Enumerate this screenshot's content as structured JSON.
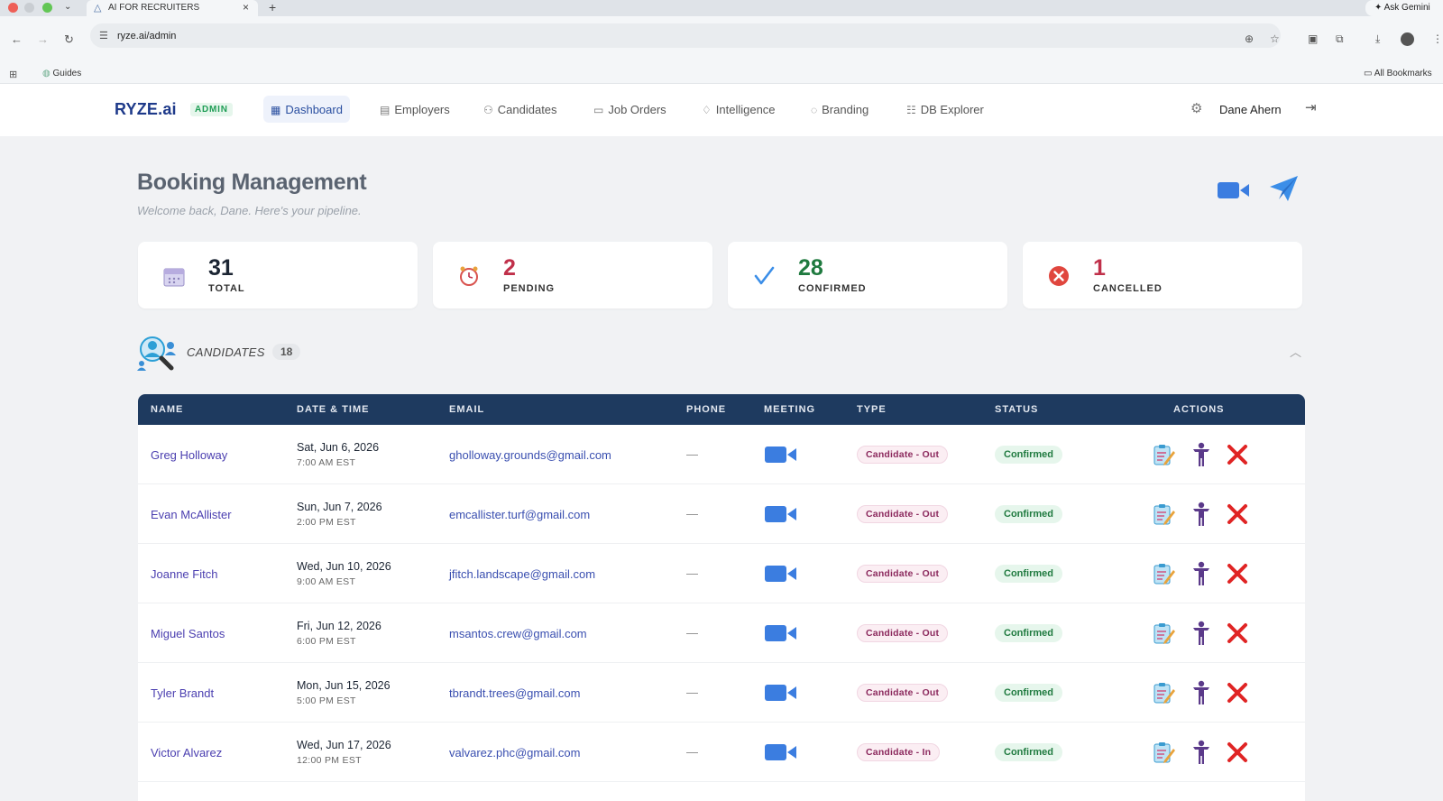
{
  "browser": {
    "tab_title": "AI FOR RECRUITERS",
    "url": "ryze.ai/admin",
    "gemini": "Ask Gemini",
    "bookmark_guides": "Guides",
    "bookmark_all": "All Bookmarks"
  },
  "nav": {
    "logo": "RYZE.ai",
    "admin_badge": "ADMIN",
    "items": [
      {
        "label": "Dashboard",
        "icon": "grid-icon"
      },
      {
        "label": "Employers",
        "icon": "building-icon"
      },
      {
        "label": "Candidates",
        "icon": "people-icon"
      },
      {
        "label": "Job Orders",
        "icon": "briefcase-icon"
      },
      {
        "label": "Intelligence",
        "icon": "lightbulb-icon"
      },
      {
        "label": "Branding",
        "icon": "palette-icon"
      },
      {
        "label": "DB Explorer",
        "icon": "database-icon"
      }
    ],
    "user_name": "Dane Ahern"
  },
  "page": {
    "title": "Booking Management",
    "subtitle": "Welcome back, Dane. Here's your pipeline."
  },
  "stats": [
    {
      "value": "31",
      "label": "TOTAL",
      "icon": "calendar-icon",
      "color": "#1c2533"
    },
    {
      "value": "2",
      "label": "PENDING",
      "icon": "alarm-clock-icon",
      "color": "#c0304a"
    },
    {
      "value": "28",
      "label": "CONFIRMED",
      "icon": "checkmark-icon",
      "color": "#1f7a3f"
    },
    {
      "value": "1",
      "label": "CANCELLED",
      "icon": "cancel-circle-icon",
      "color": "#c0304a"
    }
  ],
  "candidates": {
    "label": "CANDIDATES",
    "count": "18",
    "columns": [
      "NAME",
      "DATE & TIME",
      "EMAIL",
      "PHONE",
      "MEETING",
      "TYPE",
      "STATUS",
      "ACTIONS"
    ],
    "rows": [
      {
        "name": "Greg Holloway",
        "date": "Sat, Jun 6, 2026",
        "time": "7:00 AM EST",
        "email": "gholloway.grounds@gmail.com",
        "phone": "—",
        "type": "Candidate - Out",
        "status": "Confirmed"
      },
      {
        "name": "Evan McAllister",
        "date": "Sun, Jun 7, 2026",
        "time": "2:00 PM EST",
        "email": "emcallister.turf@gmail.com",
        "phone": "—",
        "type": "Candidate - Out",
        "status": "Confirmed"
      },
      {
        "name": "Joanne Fitch",
        "date": "Wed, Jun 10, 2026",
        "time": "9:00 AM EST",
        "email": "jfitch.landscape@gmail.com",
        "phone": "—",
        "type": "Candidate - Out",
        "status": "Confirmed"
      },
      {
        "name": "Miguel Santos",
        "date": "Fri, Jun 12, 2026",
        "time": "6:00 PM EST",
        "email": "msantos.crew@gmail.com",
        "phone": "—",
        "type": "Candidate - Out",
        "status": "Confirmed"
      },
      {
        "name": "Tyler Brandt",
        "date": "Mon, Jun 15, 2026",
        "time": "5:00 PM EST",
        "email": "tbrandt.trees@gmail.com",
        "phone": "—",
        "type": "Candidate - Out",
        "status": "Confirmed"
      },
      {
        "name": "Victor Alvarez",
        "date": "Wed, Jun 17, 2026",
        "time": "12:00 PM EST",
        "email": "valvarez.phc@gmail.com",
        "phone": "—",
        "type": "Candidate - In",
        "status": "Confirmed"
      }
    ]
  },
  "colors": {
    "accent": "#2a4fa0",
    "table_header": "#1e3a5f",
    "video_blue": "#3b7de0",
    "cancel_red": "#e02424"
  }
}
